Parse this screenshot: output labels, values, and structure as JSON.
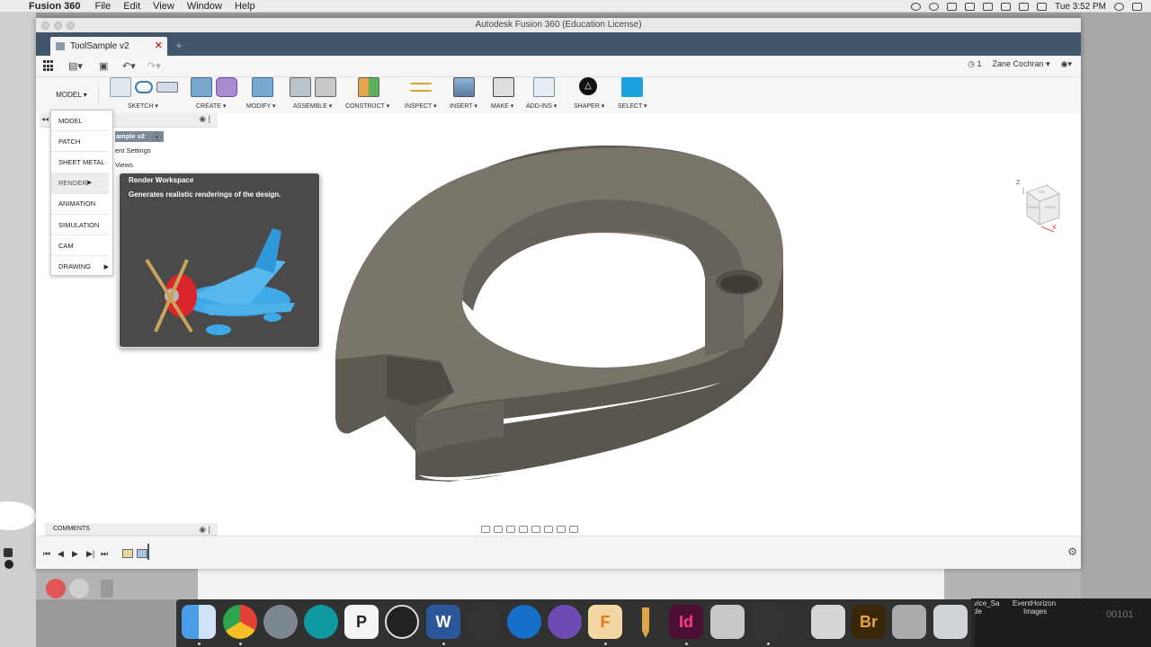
{
  "menubar": {
    "app_name": "Fusion 360",
    "items": [
      "File",
      "Edit",
      "View",
      "Window",
      "Help"
    ],
    "clock": "Tue 3:52 PM"
  },
  "window": {
    "title": "Autodesk Fusion 360 (Education License)",
    "tab_title": "ToolSample v2"
  },
  "qat": {
    "jobs_count": "1",
    "user": "Zane Cochran"
  },
  "toolbar": {
    "workspace": "MODEL",
    "groups": [
      "SKETCH",
      "CREATE",
      "MODIFY",
      "ASSEMBLE",
      "CONSTRUCT",
      "INSPECT",
      "INSERT",
      "MAKE",
      "ADD-INS",
      "SHAPER",
      "SELECT"
    ]
  },
  "browser": {
    "root": "ample v2",
    "node1": "ent Settings",
    "node2": "Views"
  },
  "workspace_menu": {
    "items": [
      "MODEL",
      "PATCH",
      "SHEET METAL",
      "RENDER",
      "ANIMATION",
      "SIMULATION",
      "CAM",
      "DRAWING"
    ],
    "hovered": "RENDER"
  },
  "tooltip": {
    "title": "Render Workspace",
    "description": "Generates realistic renderings of the design."
  },
  "viewcube": {
    "top": "TOP",
    "front": "FRONT",
    "right": "RIGHT",
    "axis_z": "Z",
    "axis_x": "X"
  },
  "comments": {
    "label": "COMMENTS"
  },
  "desktop": {
    "label1": "vice_Sa",
    "label1b": "de",
    "label2": "EventHorizon",
    "label2b": "Images",
    "label3": "00101"
  },
  "colors": {
    "tab_bar": "#41566b",
    "model_body": "#6e695f",
    "select_accent": "#1ea2dd",
    "tooltip_bg": "#4a4a4a"
  }
}
